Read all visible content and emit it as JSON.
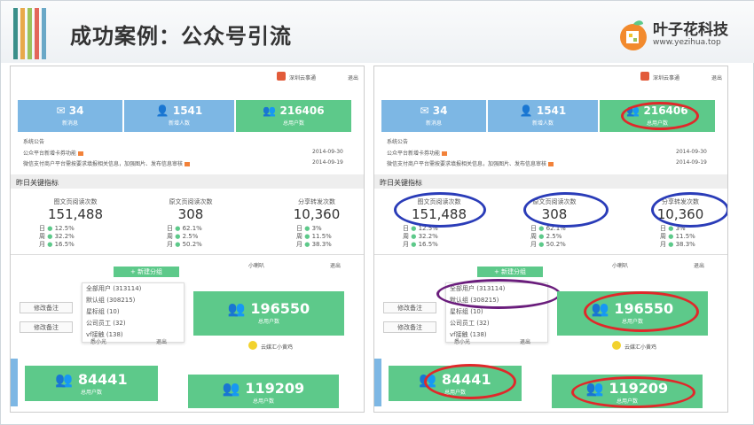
{
  "header": {
    "title": "成功案例：公众号引流",
    "logo_name": "叶子花科技",
    "logo_url": "www.yezihua.top"
  },
  "colors": {
    "accent_green": "#5dc98a",
    "accent_blue": "#7db7e4",
    "ring_red": "#e0282a",
    "ring_navy": "#2a3cb8",
    "ring_purple": "#6a1d7c"
  },
  "dashboard": {
    "top_account": "深圳云事通",
    "top_logout": "退出",
    "stats": [
      {
        "value": "34",
        "label": "新消息"
      },
      {
        "value": "1541",
        "label": "新增人数"
      },
      {
        "value": "216406",
        "label": "总用户数"
      }
    ],
    "news_title": "系统公告",
    "news": [
      {
        "text": "公众平台新增卡券功能",
        "date": "2014-09-30"
      },
      {
        "text": "微信支付商户平台需按要求填报相关信息，加强图片、发布信息审核",
        "date": "2014-09-19"
      }
    ],
    "key_title": "昨日关键指标",
    "metrics": [
      {
        "label": "图文页阅读次数",
        "value": "151,488",
        "rows": [
          [
            "日",
            "12.5%"
          ],
          [
            "周",
            "32.2%"
          ],
          [
            "月",
            "16.5%"
          ]
        ]
      },
      {
        "label": "原文页阅读次数",
        "value": "308",
        "rows": [
          [
            "日",
            "62.1%"
          ],
          [
            "周",
            "2.5%"
          ],
          [
            "月",
            "50.2%"
          ]
        ]
      },
      {
        "label": "分享转发次数",
        "value": "10,360",
        "rows": [
          [
            "日",
            "3%"
          ],
          [
            "周",
            "11.5%"
          ],
          [
            "月",
            "38.3%"
          ]
        ]
      }
    ],
    "group_bar_user": "小喇叭",
    "group_logout": "退出",
    "new_group": "+ 新建分组",
    "groups": [
      "全部用户 (313114)",
      "默认组 (308215)",
      "星标组 (10)",
      "公司员工 (32)",
      "vf接触 (138)"
    ],
    "edit_note": "修改备注",
    "card_196550": {
      "value": "196550",
      "label": "总用户数"
    },
    "foot_user": "悉小光",
    "foot_logout": "退出",
    "foot_account": "云媒汇小黄鸡",
    "card_84441": {
      "value": "84441",
      "label": "总用户数"
    },
    "card_119209": {
      "value": "119209",
      "label": "总用户数"
    }
  }
}
